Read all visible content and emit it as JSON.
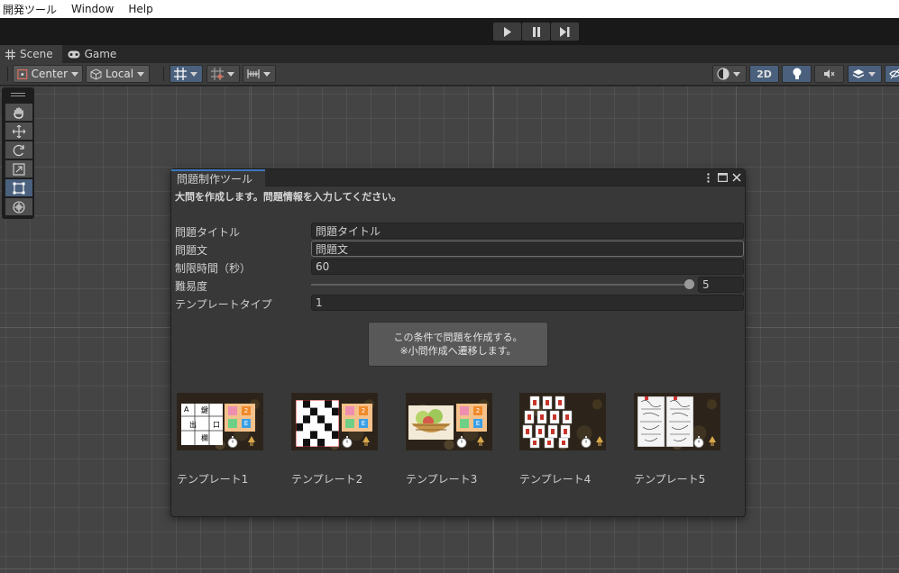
{
  "menubar": {
    "items": [
      "開発ツール",
      "Window",
      "Help"
    ]
  },
  "playbar": {
    "buttons": [
      "play-icon",
      "pause-icon",
      "step-icon"
    ]
  },
  "tabs": [
    {
      "label": "Scene",
      "icon": "grid-icon",
      "active": true
    },
    {
      "label": "Game",
      "icon": "gamepad-icon",
      "active": false
    }
  ],
  "scene_toolbar": {
    "pivot_label": "Center",
    "space_label": "Local",
    "mode_2d_label": "2D",
    "accent_color": "#4a607d"
  },
  "tools": [
    "view-tool",
    "move-tool",
    "rotate-tool",
    "scale-tool",
    "rect-tool",
    "transform-tool"
  ],
  "tool_window": {
    "title": "問題制作ツール",
    "description": "大問を作成します。問題情報を入力してください。",
    "fields": {
      "title_label": "問題タイトル",
      "title_value": "問題タイトル",
      "text_label": "問題文",
      "text_value": "問題文",
      "time_label": "制限時間（秒）",
      "time_value": "60",
      "difficulty_label": "難易度",
      "difficulty_value": "5",
      "difficulty_fraction": 1.0,
      "template_type_label": "テンプレートタイプ",
      "template_type_value": "1"
    },
    "create_button": {
      "line1": "この条件で問題を作成する。",
      "line2": "※小問作成へ遷移します。"
    },
    "templates": [
      {
        "label": "テンプレート1"
      },
      {
        "label": "テンプレート2"
      },
      {
        "label": "テンプレート3"
      },
      {
        "label": "テンプレート4"
      },
      {
        "label": "テンプレート5"
      }
    ],
    "thumb_texts": {
      "a": "A",
      "ken": "鍵",
      "de": "出",
      "kuchi": "口",
      "ka": "欄",
      "icon2": "2",
      "icon_c": "C",
      "icon_e": "E"
    }
  }
}
